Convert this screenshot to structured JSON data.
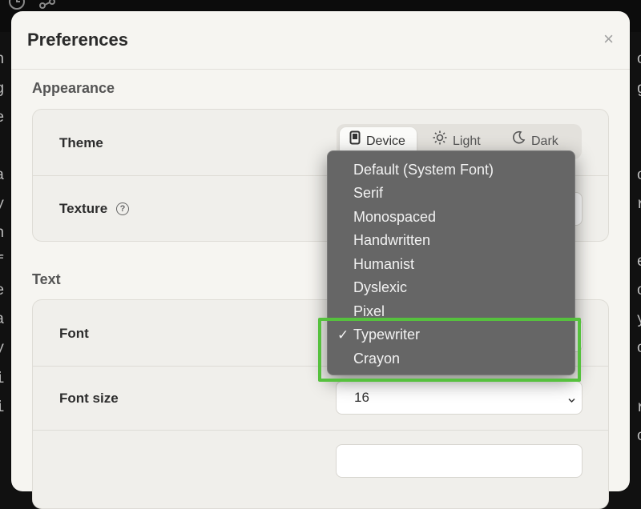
{
  "modal": {
    "title": "Preferences",
    "close_glyph": "×"
  },
  "appearance": {
    "heading": "Appearance",
    "theme": {
      "label": "Theme",
      "options": [
        {
          "label": "Device",
          "icon": "device-icon",
          "selected": true
        },
        {
          "label": "Light",
          "icon": "sun-icon",
          "selected": false
        },
        {
          "label": "Dark",
          "icon": "moon-icon",
          "selected": false
        }
      ]
    },
    "texture": {
      "label": "Texture",
      "help_glyph": "?"
    }
  },
  "text": {
    "heading": "Text",
    "font": {
      "label": "Font",
      "selected": "Typewriter",
      "options": [
        "Default (System Font)",
        "Serif",
        "Monospaced",
        "Handwritten",
        "Humanist",
        "Dyslexic",
        "Pixel",
        "Typewriter",
        "Crayon"
      ]
    },
    "font_size": {
      "label": "Font size",
      "value": "16"
    }
  },
  "dropdown": {
    "check_glyph": "✓"
  },
  "background": {
    "left_fragments": [
      "h",
      "g",
      "e",
      "a",
      "y",
      "n",
      "f",
      "e",
      "a",
      "y",
      "i",
      "i",
      "t",
      "u",
      "i"
    ],
    "right_fragments": [
      "o",
      "g",
      "",
      "o",
      "r",
      "",
      "e",
      "o",
      "y",
      "o",
      "",
      "r",
      "o",
      "e",
      "o"
    ]
  },
  "colors": {
    "highlight": "#56c13e",
    "modal_bg": "#f6f5f1",
    "dropdown_bg": "#666666"
  }
}
